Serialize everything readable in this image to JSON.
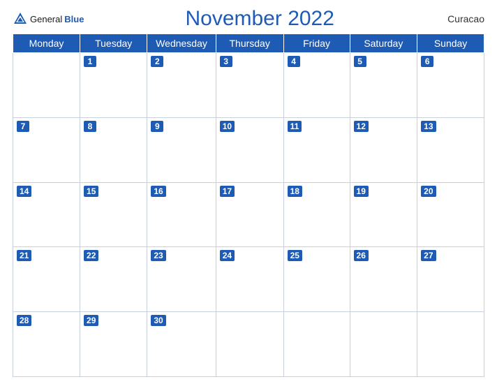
{
  "header": {
    "logo": {
      "general": "General",
      "blue": "Blue",
      "icon_alt": "GeneralBlue logo"
    },
    "title": "November 2022",
    "country": "Curacao"
  },
  "weekdays": [
    "Monday",
    "Tuesday",
    "Wednesday",
    "Thursday",
    "Friday",
    "Saturday",
    "Sunday"
  ],
  "weeks": [
    [
      null,
      1,
      2,
      3,
      4,
      5,
      6
    ],
    [
      7,
      8,
      9,
      10,
      11,
      12,
      13
    ],
    [
      14,
      15,
      16,
      17,
      18,
      19,
      20
    ],
    [
      21,
      22,
      23,
      24,
      25,
      26,
      27
    ],
    [
      28,
      29,
      30,
      null,
      null,
      null,
      null
    ]
  ]
}
